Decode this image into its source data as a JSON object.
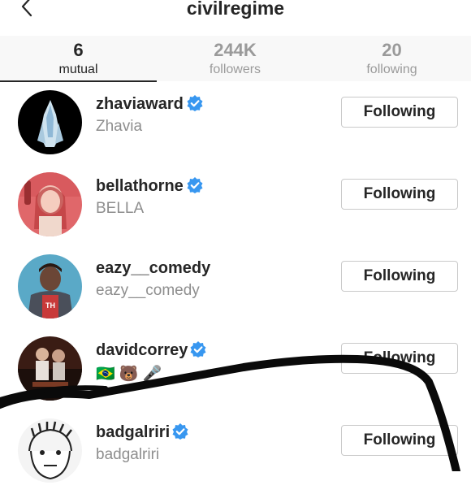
{
  "header": {
    "title": "civilregime",
    "back_icon": "chevron-left-icon"
  },
  "tabs": [
    {
      "count": "6",
      "label": "mutual",
      "active": true
    },
    {
      "count": "244K",
      "label": "followers",
      "active": false
    },
    {
      "count": "20",
      "label": "following",
      "active": false
    }
  ],
  "users": [
    {
      "username": "zhaviaward",
      "full_name": "Zhavia",
      "verified": true,
      "button": "Following"
    },
    {
      "username": "bellathorne",
      "full_name": "BELLA",
      "verified": true,
      "button": "Following"
    },
    {
      "username": "eazy__comedy",
      "full_name": "eazy__comedy",
      "verified": false,
      "button": "Following"
    },
    {
      "username": "davidcorrey",
      "full_name": "🇧🇷 🐻 🎤",
      "verified": true,
      "button": "Following"
    },
    {
      "username": "badgalriri",
      "full_name": "badgalriri",
      "verified": true,
      "button": "Following"
    }
  ],
  "colors": {
    "verified_badge": "#3897f0",
    "text": "#262626",
    "muted": "#8e8e8e",
    "tab_bg": "#f8f8f8"
  }
}
